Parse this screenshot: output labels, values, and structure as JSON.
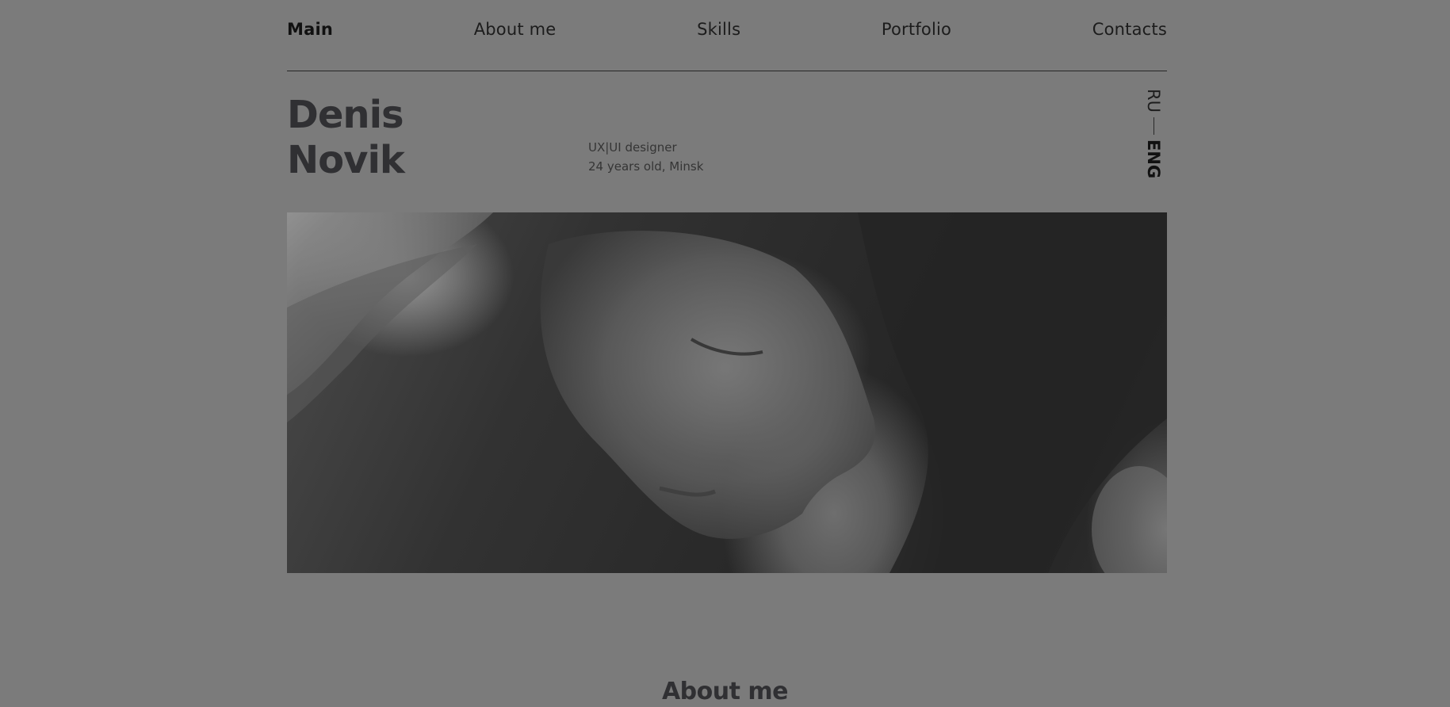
{
  "nav": {
    "items": [
      {
        "label": "Main",
        "active": true
      },
      {
        "label": "About me",
        "active": false
      },
      {
        "label": "Skills",
        "active": false
      },
      {
        "label": "Portfolio",
        "active": false
      },
      {
        "label": "Contacts",
        "active": false
      }
    ]
  },
  "header": {
    "first_name": "Denis",
    "last_name": "Novik",
    "role": "UX|UI designer",
    "info": "24 years old, Minsk"
  },
  "language": {
    "options": [
      "RU",
      "ENG"
    ],
    "active": "ENG"
  },
  "hero": {
    "image": "portrait-photo"
  },
  "about": {
    "title": "About me"
  },
  "colors": {
    "background": "#7b7b7b",
    "text_dark": "#303033",
    "nav_text": "#1c1c1c"
  }
}
